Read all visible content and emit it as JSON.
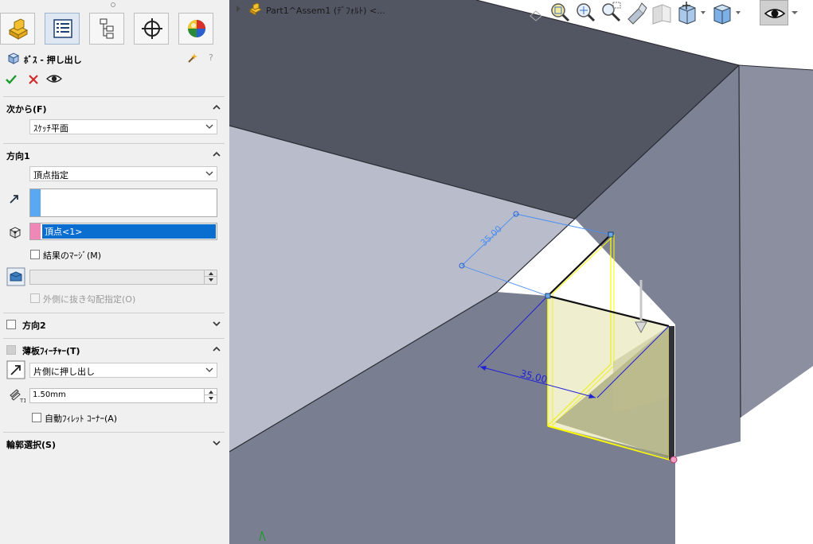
{
  "feature": {
    "title": "ﾎﾞｽ - 押し出し",
    "ok_icon": "check-icon",
    "cancel_icon": "close-icon",
    "preview_icon": "eye-icon",
    "help_icons": [
      "detailed-preview-icon",
      "help-icon"
    ]
  },
  "tabs": [
    {
      "name": "feature-manager",
      "icon": "part-icon"
    },
    {
      "name": "property-manager",
      "icon": "property-list-icon"
    },
    {
      "name": "configuration-manager",
      "icon": "config-tree-icon"
    },
    {
      "name": "dimxpert-manager",
      "icon": "crosshair-icon"
    },
    {
      "name": "display-manager",
      "icon": "appearance-sphere-icon"
    }
  ],
  "from": {
    "title": "次から(F)",
    "value": "ｽｹｯﾁ平面"
  },
  "direction1": {
    "title": "方向1",
    "end_condition": "頂点指定",
    "direction_selection": "",
    "vertex_selection": "頂点<1>",
    "merge_result_label": "結果のﾏｰｼﾞ(M)",
    "merge_result_checked": false,
    "draft_value": "",
    "draft_outward_label": "外側に抜き勾配指定(O)"
  },
  "direction2": {
    "title": "方向2",
    "checked": false
  },
  "thin_feature": {
    "title": "薄板ﾌｨｰﾁｬｰ(T)",
    "type": "片側に押し出し",
    "thickness": "1.50mm",
    "auto_fillet_label": "自動ﾌｨﾚｯﾄ ｺｰﾅｰ(A)",
    "auto_fillet_checked": false
  },
  "contour": {
    "title": "輪郭選択(S)"
  },
  "viewport": {
    "breadcrumb": "Part1^Assem1 (ﾃﾞﾌｫﾙﾄ) <...",
    "dim_blue_label": "35.00",
    "dim_light_label": "35.00",
    "hud_icons": [
      "previous-view-icon",
      "zoom-to-fit-icon",
      "zoom-to-area-icon",
      "zoom-in-out-icon",
      "rotate-icon",
      "section-view-icon",
      "view-orientation-icon",
      "display-style-icon",
      "hide-show-icon"
    ]
  },
  "colors": {
    "panel_bg": "#f0f0f0",
    "selection_blue": "#0a6ed1",
    "face_light": "#b9bccb",
    "face_top": "#525663",
    "face_side": "#7d8294",
    "preview_yellow": "#ffff00",
    "ok_green": "#1a9b2c",
    "cancel_red": "#d22b2b"
  }
}
